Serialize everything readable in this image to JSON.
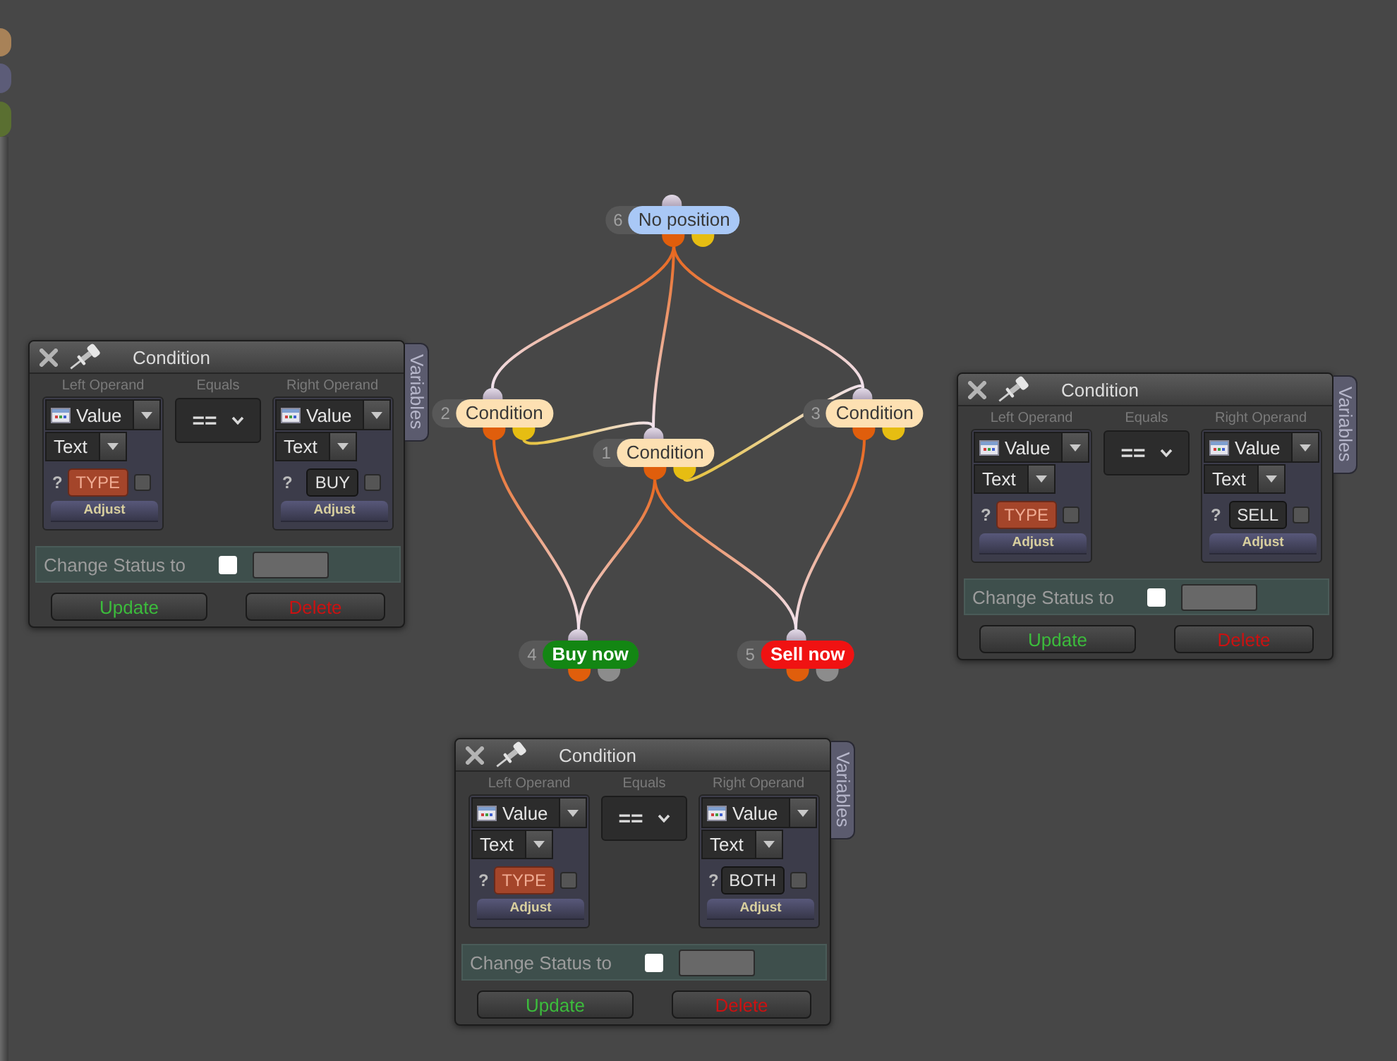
{
  "side_markers": [
    {
      "color": "#a88258"
    },
    {
      "color": "#5c5c78"
    },
    {
      "color": "#5a6f31"
    }
  ],
  "diagram": {
    "nodes": [
      {
        "number": "6",
        "label": "No position",
        "kind": "state",
        "color": "#a9c8f6"
      },
      {
        "number": "2",
        "label": "Condition",
        "kind": "condition",
        "color": "#fde0b2"
      },
      {
        "number": "1",
        "label": "Condition",
        "kind": "condition",
        "color": "#fde0b2"
      },
      {
        "number": "3",
        "label": "Condition",
        "kind": "condition",
        "color": "#fde0b2"
      },
      {
        "number": "4",
        "label": "Buy now",
        "kind": "action",
        "color": "#138613"
      },
      {
        "number": "5",
        "label": "Sell now",
        "kind": "action",
        "color": "#f01212"
      }
    ],
    "edges": [
      {
        "kind": "primary"
      },
      {
        "kind": "primary"
      },
      {
        "kind": "primary"
      },
      {
        "kind": "secondary"
      },
      {
        "kind": "secondary"
      },
      {
        "kind": "primary"
      },
      {
        "kind": "primary"
      },
      {
        "kind": "primary"
      },
      {
        "kind": "primary"
      }
    ]
  },
  "panels": [
    {
      "title": "Condition",
      "side_tab": "Variables",
      "left_operand": {
        "heading": "Left Operand",
        "source": "Value",
        "type": "Text",
        "prefix": "?",
        "value": "TYPE",
        "kind": "variable",
        "checked": false,
        "adjust": "Adjust"
      },
      "operator": {
        "heading": "Equals",
        "value": "=="
      },
      "right_operand": {
        "heading": "Right Operand",
        "source": "Value",
        "type": "Text",
        "prefix": "?",
        "value": "BUY",
        "kind": "literal",
        "checked": false,
        "adjust": "Adjust"
      },
      "change_status": {
        "label": "Change Status to",
        "checked": false
      },
      "buttons": [
        {
          "label": "Update",
          "kind": "update"
        },
        {
          "label": "Delete",
          "kind": "delete"
        }
      ]
    },
    {
      "title": "Condition",
      "side_tab": "Variables",
      "left_operand": {
        "heading": "Left Operand",
        "source": "Value",
        "type": "Text",
        "prefix": "?",
        "value": "TYPE",
        "kind": "variable",
        "checked": false,
        "adjust": "Adjust"
      },
      "operator": {
        "heading": "Equals",
        "value": "=="
      },
      "right_operand": {
        "heading": "Right Operand",
        "source": "Value",
        "type": "Text",
        "prefix": "?",
        "value": "SELL",
        "kind": "literal",
        "checked": false,
        "adjust": "Adjust"
      },
      "change_status": {
        "label": "Change Status to",
        "checked": false
      },
      "buttons": [
        {
          "label": "Update",
          "kind": "update"
        },
        {
          "label": "Delete",
          "kind": "delete"
        }
      ]
    },
    {
      "title": "Condition",
      "side_tab": "Variables",
      "left_operand": {
        "heading": "Left Operand",
        "source": "Value",
        "type": "Text",
        "prefix": "?",
        "value": "TYPE",
        "kind": "variable",
        "checked": false,
        "adjust": "Adjust"
      },
      "operator": {
        "heading": "Equals",
        "value": "=="
      },
      "right_operand": {
        "heading": "Right Operand",
        "source": "Value",
        "type": "Text",
        "prefix": "?",
        "value": "BOTH",
        "kind": "literal",
        "checked": false,
        "adjust": "Adjust"
      },
      "change_status": {
        "label": "Change Status to",
        "checked": false
      },
      "buttons": [
        {
          "label": "Update",
          "kind": "update"
        },
        {
          "label": "Delete",
          "kind": "delete"
        }
      ]
    }
  ]
}
